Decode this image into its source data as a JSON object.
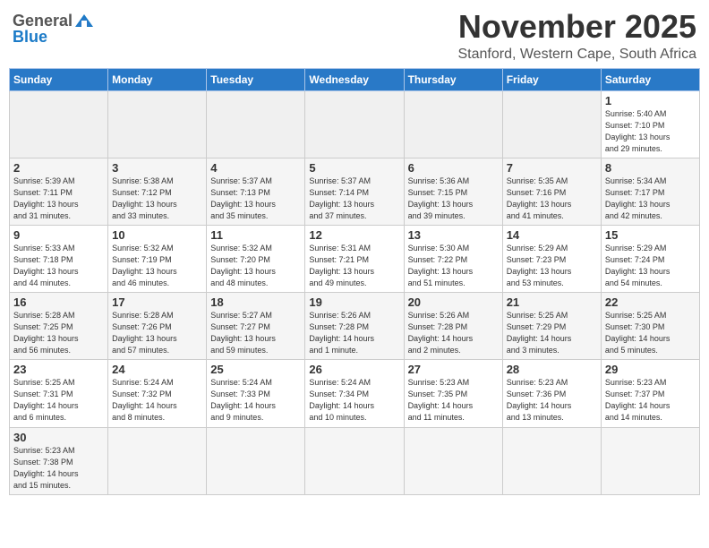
{
  "header": {
    "logo_general": "General",
    "logo_blue": "Blue",
    "month": "November 2025",
    "location": "Stanford, Western Cape, South Africa"
  },
  "days_of_week": [
    "Sunday",
    "Monday",
    "Tuesday",
    "Wednesday",
    "Thursday",
    "Friday",
    "Saturday"
  ],
  "weeks": [
    [
      {
        "day": "",
        "info": ""
      },
      {
        "day": "",
        "info": ""
      },
      {
        "day": "",
        "info": ""
      },
      {
        "day": "",
        "info": ""
      },
      {
        "day": "",
        "info": ""
      },
      {
        "day": "",
        "info": ""
      },
      {
        "day": "1",
        "info": "Sunrise: 5:40 AM\nSunset: 7:10 PM\nDaylight: 13 hours\nand 29 minutes."
      }
    ],
    [
      {
        "day": "2",
        "info": "Sunrise: 5:39 AM\nSunset: 7:11 PM\nDaylight: 13 hours\nand 31 minutes."
      },
      {
        "day": "3",
        "info": "Sunrise: 5:38 AM\nSunset: 7:12 PM\nDaylight: 13 hours\nand 33 minutes."
      },
      {
        "day": "4",
        "info": "Sunrise: 5:37 AM\nSunset: 7:13 PM\nDaylight: 13 hours\nand 35 minutes."
      },
      {
        "day": "5",
        "info": "Sunrise: 5:37 AM\nSunset: 7:14 PM\nDaylight: 13 hours\nand 37 minutes."
      },
      {
        "day": "6",
        "info": "Sunrise: 5:36 AM\nSunset: 7:15 PM\nDaylight: 13 hours\nand 39 minutes."
      },
      {
        "day": "7",
        "info": "Sunrise: 5:35 AM\nSunset: 7:16 PM\nDaylight: 13 hours\nand 41 minutes."
      },
      {
        "day": "8",
        "info": "Sunrise: 5:34 AM\nSunset: 7:17 PM\nDaylight: 13 hours\nand 42 minutes."
      }
    ],
    [
      {
        "day": "9",
        "info": "Sunrise: 5:33 AM\nSunset: 7:18 PM\nDaylight: 13 hours\nand 44 minutes."
      },
      {
        "day": "10",
        "info": "Sunrise: 5:32 AM\nSunset: 7:19 PM\nDaylight: 13 hours\nand 46 minutes."
      },
      {
        "day": "11",
        "info": "Sunrise: 5:32 AM\nSunset: 7:20 PM\nDaylight: 13 hours\nand 48 minutes."
      },
      {
        "day": "12",
        "info": "Sunrise: 5:31 AM\nSunset: 7:21 PM\nDaylight: 13 hours\nand 49 minutes."
      },
      {
        "day": "13",
        "info": "Sunrise: 5:30 AM\nSunset: 7:22 PM\nDaylight: 13 hours\nand 51 minutes."
      },
      {
        "day": "14",
        "info": "Sunrise: 5:29 AM\nSunset: 7:23 PM\nDaylight: 13 hours\nand 53 minutes."
      },
      {
        "day": "15",
        "info": "Sunrise: 5:29 AM\nSunset: 7:24 PM\nDaylight: 13 hours\nand 54 minutes."
      }
    ],
    [
      {
        "day": "16",
        "info": "Sunrise: 5:28 AM\nSunset: 7:25 PM\nDaylight: 13 hours\nand 56 minutes."
      },
      {
        "day": "17",
        "info": "Sunrise: 5:28 AM\nSunset: 7:26 PM\nDaylight: 13 hours\nand 57 minutes."
      },
      {
        "day": "18",
        "info": "Sunrise: 5:27 AM\nSunset: 7:27 PM\nDaylight: 13 hours\nand 59 minutes."
      },
      {
        "day": "19",
        "info": "Sunrise: 5:26 AM\nSunset: 7:28 PM\nDaylight: 14 hours\nand 1 minute."
      },
      {
        "day": "20",
        "info": "Sunrise: 5:26 AM\nSunset: 7:28 PM\nDaylight: 14 hours\nand 2 minutes."
      },
      {
        "day": "21",
        "info": "Sunrise: 5:25 AM\nSunset: 7:29 PM\nDaylight: 14 hours\nand 3 minutes."
      },
      {
        "day": "22",
        "info": "Sunrise: 5:25 AM\nSunset: 7:30 PM\nDaylight: 14 hours\nand 5 minutes."
      }
    ],
    [
      {
        "day": "23",
        "info": "Sunrise: 5:25 AM\nSunset: 7:31 PM\nDaylight: 14 hours\nand 6 minutes."
      },
      {
        "day": "24",
        "info": "Sunrise: 5:24 AM\nSunset: 7:32 PM\nDaylight: 14 hours\nand 8 minutes."
      },
      {
        "day": "25",
        "info": "Sunrise: 5:24 AM\nSunset: 7:33 PM\nDaylight: 14 hours\nand 9 minutes."
      },
      {
        "day": "26",
        "info": "Sunrise: 5:24 AM\nSunset: 7:34 PM\nDaylight: 14 hours\nand 10 minutes."
      },
      {
        "day": "27",
        "info": "Sunrise: 5:23 AM\nSunset: 7:35 PM\nDaylight: 14 hours\nand 11 minutes."
      },
      {
        "day": "28",
        "info": "Sunrise: 5:23 AM\nSunset: 7:36 PM\nDaylight: 14 hours\nand 13 minutes."
      },
      {
        "day": "29",
        "info": "Sunrise: 5:23 AM\nSunset: 7:37 PM\nDaylight: 14 hours\nand 14 minutes."
      }
    ],
    [
      {
        "day": "30",
        "info": "Sunrise: 5:23 AM\nSunset: 7:38 PM\nDaylight: 14 hours\nand 15 minutes."
      },
      {
        "day": "",
        "info": ""
      },
      {
        "day": "",
        "info": ""
      },
      {
        "day": "",
        "info": ""
      },
      {
        "day": "",
        "info": ""
      },
      {
        "day": "",
        "info": ""
      },
      {
        "day": "",
        "info": ""
      }
    ]
  ]
}
